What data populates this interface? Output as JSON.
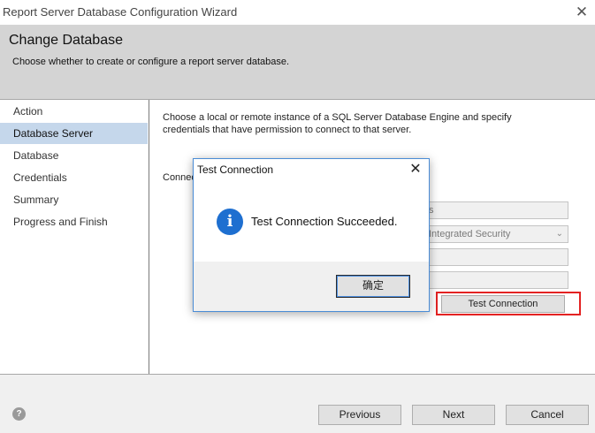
{
  "window": {
    "title": "Report Server Database Configuration Wizard",
    "close_icon": "close-icon"
  },
  "header": {
    "title": "Change Database",
    "subtitle": "Choose whether to create or configure a report server database."
  },
  "nav": {
    "items": [
      {
        "label": "Action",
        "active": false
      },
      {
        "label": "Database Server",
        "active": true
      },
      {
        "label": "Database",
        "active": false
      },
      {
        "label": "Credentials",
        "active": false
      },
      {
        "label": "Summary",
        "active": false
      },
      {
        "label": "Progress and Finish",
        "active": false
      }
    ]
  },
  "main": {
    "intro": "Choose a local or remote instance of a SQL Server Database Engine and specify credentials that have permission to connect to that server.",
    "connect_label": "Connec",
    "fields": [
      {
        "value": "s"
      },
      {
        "value": "Integrated Security"
      },
      {
        "value": ""
      },
      {
        "value": ""
      }
    ],
    "test_button": "Test Connection"
  },
  "footer": {
    "help_icon": "help-icon",
    "previous": "Previous",
    "next": "Next",
    "cancel": "Cancel"
  },
  "dialog": {
    "title": "Test Connection",
    "message": "Test Connection Succeeded.",
    "ok": "确定",
    "icon": "info-icon"
  },
  "colors": {
    "highlight": "#e32222",
    "nav_selected": "#c5d7eb",
    "info_blue": "#1e6fd0"
  }
}
